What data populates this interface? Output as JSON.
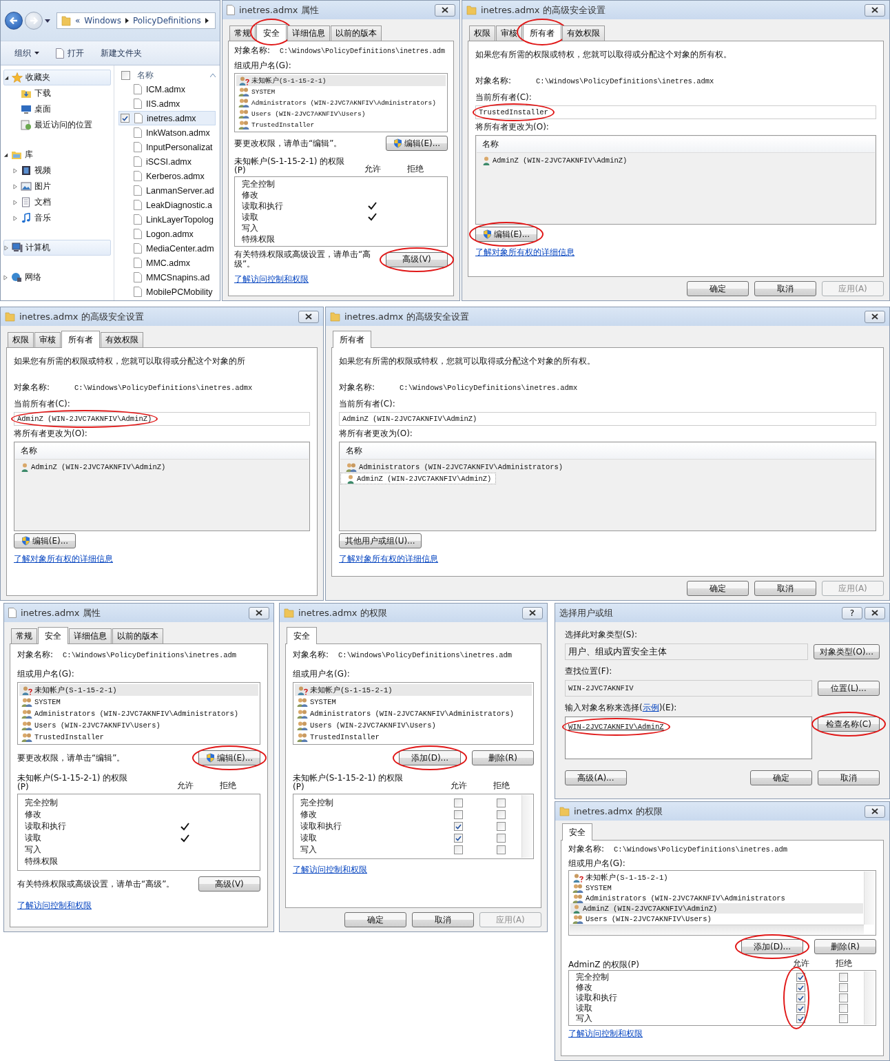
{
  "windows": [
    {
      "kind": "explorer",
      "breadcrumb": [
        "«",
        "Windows",
        "PolicyDefinitions"
      ],
      "toolbar": [
        {
          "label": "组织",
          "kind": "menu"
        },
        {
          "label": "打开",
          "kind": "open"
        },
        {
          "label": "新建文件夹",
          "kind": "plain"
        }
      ],
      "tree": [
        {
          "label": "收藏夹",
          "expanded": true,
          "selected": true,
          "children": [
            {
              "label": "下载"
            },
            {
              "label": "桌面"
            },
            {
              "label": "最近访问的位置"
            }
          ]
        },
        {
          "label": "库",
          "expanded": true,
          "selected": false,
          "children": [
            {
              "label": "视频",
              "expanded": false
            },
            {
              "label": "图片",
              "expanded": false
            },
            {
              "label": "文档",
              "expanded": false
            },
            {
              "label": "音乐",
              "expanded": false
            }
          ]
        },
        {
          "label": "计算机",
          "expanded": false,
          "selected": true
        },
        {
          "label": "网络",
          "expanded": false,
          "selected": false
        }
      ],
      "select_all_checked": false,
      "column": "名称",
      "files": [
        {
          "name": "ICM.admx",
          "selected": false,
          "checked": false
        },
        {
          "name": "IIS.admx",
          "selected": false,
          "checked": false
        },
        {
          "name": "inetres.admx",
          "selected": true,
          "checked": true
        },
        {
          "name": "InkWatson.admx",
          "selected": false,
          "checked": false
        },
        {
          "name": "InputPersonalizat",
          "selected": false,
          "checked": false
        },
        {
          "name": "iSCSI.admx",
          "selected": false,
          "checked": false
        },
        {
          "name": "Kerberos.admx",
          "selected": false,
          "checked": false
        },
        {
          "name": "LanmanServer.ad",
          "selected": false,
          "checked": false
        },
        {
          "name": "LeakDiagnostic.a",
          "selected": false,
          "checked": false
        },
        {
          "name": "LinkLayerTopolog",
          "selected": false,
          "checked": false
        },
        {
          "name": "Logon.admx",
          "selected": false,
          "checked": false
        },
        {
          "name": "MediaCenter.adm",
          "selected": false,
          "checked": false
        },
        {
          "name": "MMC.admx",
          "selected": false,
          "checked": false
        },
        {
          "name": "MMCSnapins.ad",
          "selected": false,
          "checked": false
        },
        {
          "name": "MobilePCMobility",
          "selected": false,
          "checked": false
        }
      ]
    },
    {
      "kind": "properties",
      "title": "inetres.admx 属性",
      "tabs": [
        {
          "label": "常规",
          "selected": false,
          "circled": false
        },
        {
          "label": "安全",
          "selected": true,
          "circled": true
        },
        {
          "label": "详细信息",
          "selected": false,
          "circled": false
        },
        {
          "label": "以前的版本",
          "selected": false,
          "circled": false
        }
      ],
      "object_label": "对象名称:",
      "object_value": "C:\\Windows\\PolicyDefinitions\\inetres.adm",
      "group_label": "组或用户名(G):",
      "principals": [
        {
          "name": "未知帐户(S-1-15-2-1)",
          "kind": "unknown",
          "selected": true
        },
        {
          "name": "SYSTEM",
          "kind": "group",
          "selected": false
        },
        {
          "name": "Administrators (WIN-2JVC7AKNFIV\\Administrators)",
          "kind": "group",
          "selected": false
        },
        {
          "name": "Users (WIN-2JVC7AKNFIV\\Users)",
          "kind": "group",
          "selected": false
        },
        {
          "name": "TrustedInstaller",
          "kind": "group",
          "selected": false
        }
      ],
      "edit_hint": "要更改权限，请单击“编辑”。",
      "edit_button": {
        "label": "编辑(E)...",
        "shield": true,
        "circled": false
      },
      "perm_label": "未知帐户(S-1-15-2-1) 的权限(P)",
      "allow_label": "允许",
      "deny_label": "拒绝",
      "permissions": [
        {
          "name": "完全控制",
          "allow": false,
          "deny": false
        },
        {
          "name": "修改",
          "allow": false,
          "deny": false
        },
        {
          "name": "读取和执行",
          "allow": true,
          "deny": false
        },
        {
          "name": "读取",
          "allow": true,
          "deny": false
        },
        {
          "name": "写入",
          "allow": false,
          "deny": false
        },
        {
          "name": "特殊权限",
          "allow": false,
          "deny": false
        }
      ],
      "advanced_hint": "有关特殊权限或高级设置，请单击“高级”。",
      "advanced_button": {
        "label": "高级(V)",
        "circled": true
      },
      "link": "了解访问控制和权限"
    },
    {
      "kind": "advanced",
      "title": "inetres.admx 的高级安全设置",
      "tabs": [
        {
          "label": "权限",
          "selected": false,
          "circled": false
        },
        {
          "label": "审核",
          "selected": false,
          "circled": false
        },
        {
          "label": "所有者",
          "selected": true,
          "circled": true
        },
        {
          "label": "有效权限",
          "selected": false,
          "circled": false
        }
      ],
      "intro": "如果您有所需的权限或特权，您就可以取得或分配这个对象的所有权。",
      "object_label": "对象名称:",
      "object_value": "C:\\Windows\\PolicyDefinitions\\inetres.admx",
      "owner_label": "当前所有者(C):",
      "owner": {
        "value": "TrustedInstaller",
        "circled": true
      },
      "change_label": "将所有者更改为(O):",
      "column": "名称",
      "candidates": [
        {
          "name": "AdminZ (WIN-2JVC7AKNFIV\\AdminZ)",
          "kind": "user",
          "selected": false
        }
      ],
      "action_button": {
        "label": "编辑(E)...",
        "shield": true,
        "circled": true
      },
      "link": "了解对象所有权的详细信息",
      "footer": [
        {
          "label": "确定",
          "disabled": false
        },
        {
          "label": "取消",
          "disabled": false
        },
        {
          "label": "应用(A)",
          "disabled": true
        }
      ]
    },
    {
      "kind": "advanced",
      "title": "inetres.admx 的高级安全设置",
      "tabs": [
        {
          "label": "权限",
          "selected": false,
          "circled": false
        },
        {
          "label": "审核",
          "selected": false,
          "circled": false
        },
        {
          "label": "所有者",
          "selected": true,
          "circled": false
        },
        {
          "label": "有效权限",
          "selected": false,
          "circled": false
        }
      ],
      "intro": "如果您有所需的权限或特权，您就可以取得或分配这个对象的所",
      "object_label": "对象名称:",
      "object_value": "C:\\Windows\\PolicyDefinitions\\inetres.admx",
      "owner_label": "当前所有者(C):",
      "owner": {
        "value": "AdminZ (WIN-2JVC7AKNFIV\\AdminZ)",
        "circled": true
      },
      "change_label": "将所有者更改为(O):",
      "column": "名称",
      "candidates": [
        {
          "name": "AdminZ (WIN-2JVC7AKNFIV\\AdminZ)",
          "kind": "user",
          "selected": false
        }
      ],
      "action_button": {
        "label": "编辑(E)...",
        "shield": true,
        "circled": false
      },
      "link": "了解对象所有权的详细信息"
    },
    {
      "kind": "advanced",
      "title": "inetres.admx 的高级安全设置",
      "tabs": [
        {
          "label": "所有者",
          "selected": true,
          "circled": false
        }
      ],
      "intro": "如果您有所需的权限或特权，您就可以取得或分配这个对象的所有权。",
      "object_label": "对象名称:",
      "object_value": "C:\\Windows\\PolicyDefinitions\\inetres.admx",
      "owner_label": "当前所有者(C):",
      "owner": {
        "value": "AdminZ (WIN-2JVC7AKNFIV\\AdminZ)",
        "circled": false
      },
      "change_label": "将所有者更改为(O):",
      "column": "名称",
      "candidates": [
        {
          "name": "Administrators (WIN-2JVC7AKNFIV\\Administrators)",
          "kind": "group",
          "selected": false
        },
        {
          "name": "AdminZ (WIN-2JVC7AKNFIV\\AdminZ)",
          "kind": "user",
          "selected": true
        }
      ],
      "action_button": {
        "label": "其他用户或组(U)...",
        "shield": false,
        "circled": false
      },
      "link": "了解对象所有权的详细信息",
      "footer": [
        {
          "label": "确定",
          "disabled": false
        },
        {
          "label": "取消",
          "disabled": false
        },
        {
          "label": "应用(A)",
          "disabled": true
        }
      ]
    },
    {
      "kind": "properties",
      "title": "inetres.admx 属性",
      "tabs": [
        {
          "label": "常规",
          "selected": false,
          "circled": false
        },
        {
          "label": "安全",
          "selected": true,
          "circled": false
        },
        {
          "label": "详细信息",
          "selected": false,
          "circled": false
        },
        {
          "label": "以前的版本",
          "selected": false,
          "circled": false
        }
      ],
      "object_label": "对象名称:",
      "object_value": "C:\\Windows\\PolicyDefinitions\\inetres.adm",
      "group_label": "组或用户名(G):",
      "principals": [
        {
          "name": "未知帐户(S-1-15-2-1)",
          "kind": "unknown",
          "selected": true
        },
        {
          "name": "SYSTEM",
          "kind": "group",
          "selected": false
        },
        {
          "name": "Administrators (WIN-2JVC7AKNFIV\\Administrators)",
          "kind": "group",
          "selected": false
        },
        {
          "name": "Users (WIN-2JVC7AKNFIV\\Users)",
          "kind": "group",
          "selected": false
        },
        {
          "name": "TrustedInstaller",
          "kind": "group",
          "selected": false
        }
      ],
      "edit_hint": "要更改权限，请单击“编辑”。",
      "edit_button": {
        "label": "编辑(E)...",
        "shield": true,
        "circled": true
      },
      "perm_label": "未知帐户(S-1-15-2-1) 的权限(P)",
      "allow_label": "允许",
      "deny_label": "拒绝",
      "permissions": [
        {
          "name": "完全控制",
          "allow": false,
          "deny": false
        },
        {
          "name": "修改",
          "allow": false,
          "deny": false
        },
        {
          "name": "读取和执行",
          "allow": true,
          "deny": false
        },
        {
          "name": "读取",
          "allow": true,
          "deny": false
        },
        {
          "name": "写入",
          "allow": false,
          "deny": false
        },
        {
          "name": "特殊权限",
          "allow": false,
          "deny": false
        }
      ],
      "advanced_hint": "有关特殊权限或高级设置，请单击“高级”。",
      "advanced_button": {
        "label": "高级(V)",
        "circled": false
      },
      "link": "了解访问控制和权限"
    },
    {
      "kind": "permissions",
      "title": "inetres.admx 的权限",
      "tabs": [
        {
          "label": "安全",
          "selected": true,
          "circled": false
        }
      ],
      "object_label": "对象名称:",
      "object_value": "C:\\Windows\\PolicyDefinitions\\inetres.adm",
      "group_label": "组或用户名(G):",
      "principals": [
        {
          "name": "未知帐户(S-1-15-2-1)",
          "kind": "unknown",
          "selected": true
        },
        {
          "name": "SYSTEM",
          "kind": "group",
          "selected": false
        },
        {
          "name": "Administrators (WIN-2JVC7AKNFIV\\Administrators)",
          "kind": "group",
          "selected": false
        },
        {
          "name": "Users (WIN-2JVC7AKNFIV\\Users)",
          "kind": "group",
          "selected": false
        },
        {
          "name": "TrustedInstaller",
          "kind": "group",
          "selected": false
        }
      ],
      "add_button": {
        "label": "添加(D)...",
        "circled": true
      },
      "remove_button": {
        "label": "删除(R)",
        "circled": false
      },
      "perm_label": "未知帐户(S-1-15-2-1) 的权限(P)",
      "allow_label": "允许",
      "deny_label": "拒绝",
      "permissions": [
        {
          "name": "完全控制",
          "allow": false,
          "deny": false
        },
        {
          "name": "修改",
          "allow": false,
          "deny": false
        },
        {
          "name": "读取和执行",
          "allow": true,
          "deny": false
        },
        {
          "name": "读取",
          "allow": true,
          "deny": false
        },
        {
          "name": "写入",
          "allow": false,
          "deny": false
        }
      ],
      "allow_circled": false,
      "link": "了解访问控制和权限",
      "footer": [
        {
          "label": "确定",
          "disabled": false
        },
        {
          "label": "取消",
          "disabled": false
        },
        {
          "label": "应用(A)",
          "disabled": true
        }
      ]
    },
    {
      "kind": "select",
      "title": "选择用户或组",
      "help_button": "?",
      "type_label": "选择此对象类型(S):",
      "type_value": "用户、组或内置安全主体",
      "type_button": {
        "label": "对象类型(O)...",
        "circled": false
      },
      "location_label": "查找位置(F):",
      "location_value": "WIN-2JVC7AKNFIV",
      "location_button": {
        "label": "位置(L)...",
        "circled": false
      },
      "names_label": "输入对象名称来选择(",
      "names_example": "示例",
      "names_label_end": ")(E):",
      "names": {
        "value": "WIN-2JVC7AKNFIV\\AdminZ",
        "circled": true
      },
      "check_button": {
        "label": "检查名称(C)",
        "circled": true
      },
      "advanced_button": {
        "label": "高级(A)...",
        "circled": false
      },
      "footer": [
        {
          "label": "确定",
          "disabled": false
        },
        {
          "label": "取消",
          "disabled": false
        }
      ]
    },
    {
      "kind": "permissions",
      "title": "inetres.admx 的权限",
      "tabs": [
        {
          "label": "安全",
          "selected": true,
          "circled": false
        }
      ],
      "object_label": "对象名称:",
      "object_value": "C:\\Windows\\PolicyDefinitions\\inetres.adm",
      "group_label": "组或用户名(G):",
      "principals": [
        {
          "name": "未知帐户(S-1-15-2-1)",
          "kind": "unknown",
          "selected": false
        },
        {
          "name": "SYSTEM",
          "kind": "group",
          "selected": false
        },
        {
          "name": "Administrators (WIN-2JVC7AKNFIV\\Administrators",
          "kind": "group",
          "selected": false
        },
        {
          "name": "AdminZ (WIN-2JVC7AKNFIV\\AdminZ)",
          "kind": "user",
          "selected": true
        },
        {
          "name": "Users (WIN-2JVC7AKNFIV\\Users)",
          "kind": "group",
          "selected": false
        }
      ],
      "add_button": {
        "label": "添加(D)...",
        "circled": true
      },
      "remove_button": {
        "label": "删除(R)",
        "circled": false
      },
      "perm_label": "AdminZ 的权限(P)",
      "allow_label": "允许",
      "deny_label": "拒绝",
      "permissions": [
        {
          "name": "完全控制",
          "allow": true,
          "deny": false
        },
        {
          "name": "修改",
          "allow": true,
          "deny": false
        },
        {
          "name": "读取和执行",
          "allow": true,
          "deny": false
        },
        {
          "name": "读取",
          "allow": true,
          "deny": false
        },
        {
          "name": "写入",
          "allow": true,
          "deny": false
        }
      ],
      "allow_circled": true,
      "link": "了解访问控制和权限"
    }
  ]
}
